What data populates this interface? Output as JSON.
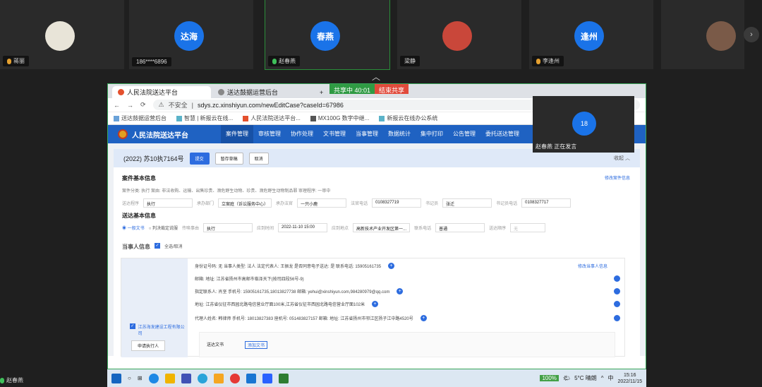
{
  "participants": [
    {
      "name": "蒋丽",
      "avatar": "photo"
    },
    {
      "name": "186****6896",
      "avatar": "达海"
    },
    {
      "name": "赵春燕",
      "avatar": "春燕"
    },
    {
      "name": "梁静",
      "avatar": "photo"
    },
    {
      "name": "李逢州",
      "avatar": "逢州"
    },
    {
      "name": "",
      "avatar": "photo"
    }
  ],
  "share": {
    "status": "共享中 40:01",
    "end": "结束共享"
  },
  "browser": {
    "tabs": [
      "人民法院送达平台",
      "送达鼓据运营后台"
    ],
    "security": "不安全",
    "url": "sdys.zc.xinshiyun.com/newEditCase?caseId=67986",
    "bookmarks": [
      "送达鼓据运营后台",
      "智慧 | 新报云在线...",
      "人民法院送达平台...",
      "MX100G 数字中继...",
      "新报云在线办公系统"
    ]
  },
  "app": {
    "title": "人民法院送达平台",
    "menu": [
      "案件管理",
      "审核管理",
      "协作处理",
      "文书管理",
      "当事管理",
      "数据统计",
      "集中打印",
      "公告管理",
      "委托送达管理"
    ],
    "case_no": "(2022) 苏10执7164号",
    "buttons": [
      "提交",
      "暂存草稿",
      "取消"
    ],
    "collapse": "收起",
    "basic_title": "案件基本信息",
    "edit_link": "修改案件信息",
    "basic_line": "案件分类:  执行  案由:  非法收购、运输、出售珍贵、濒危野生动物、珍贵、濒危野生动物制品罪  审理程序:  一审中",
    "f1": {
      "l1": "送达程序",
      "v1": "执行",
      "l2": "承办部门",
      "v2": "立案庭（诉讼服务中心）",
      "l3": "承办法官",
      "v3": "一只小鹿",
      "l4": "法官电话",
      "v4": "0108327719",
      "l5": "书记员",
      "v5": "张迁",
      "l6": "书记员电话",
      "v6": "0108327717"
    },
    "delivery_title": "送达基本信息",
    "f2": {
      "r1": "一般文书",
      "r2": "判决裁定说服",
      "l2": "传唤事由",
      "v2": "执行",
      "l3": "应到时间",
      "v3": "2022-11-10 15:00",
      "l4": "应到地点",
      "v4": "高新技术产业开发区第一...",
      "l5": "联系电话",
      "v5": "普通",
      "l6": "送达顺序",
      "v6": "无"
    },
    "party_title": "当事人信息",
    "select_all": "全选/取消",
    "party_edit": "修改当事人信息",
    "p1": "身份证号码:  无     当事人类型:  法人     法定代表人:  王振龙     是否同意电子送达:  是     联系电话:  15905161735",
    "p2": "邮箱:     地址:  江苏省扬州市高邮市临泽天下(按司四段56号-9)",
    "p3": "指定联系人:  肖坚     手机号:  15905161735,18013827738     邮箱:  yehui@xinshiyun.com,984280979@qq.com",
    "p4": "地址:  江苏省仪征市西园北路电信营业厅面100米,江苏省仪征市西园北路电信营业厅面102米",
    "p5": "代理人姓名:  韩律师     手机号:  18013827383     座机号:  051483827157     邮箱:     地址:  江苏省扬州市邗江区扬子江中路4520号",
    "company": "江苏海发建设工程有限公司",
    "role": "申请执行人",
    "doc_tab": "送达文书",
    "add_doc": "添加文书"
  },
  "speaker": {
    "avatar": "18",
    "caption": "赵春燕 正在发言"
  },
  "taskbar": {
    "battery": "100%",
    "weather": "5°C 晴朗",
    "ime": "中",
    "time": "15:16",
    "date": "2022/11/15"
  },
  "self_name": "赵春燕"
}
